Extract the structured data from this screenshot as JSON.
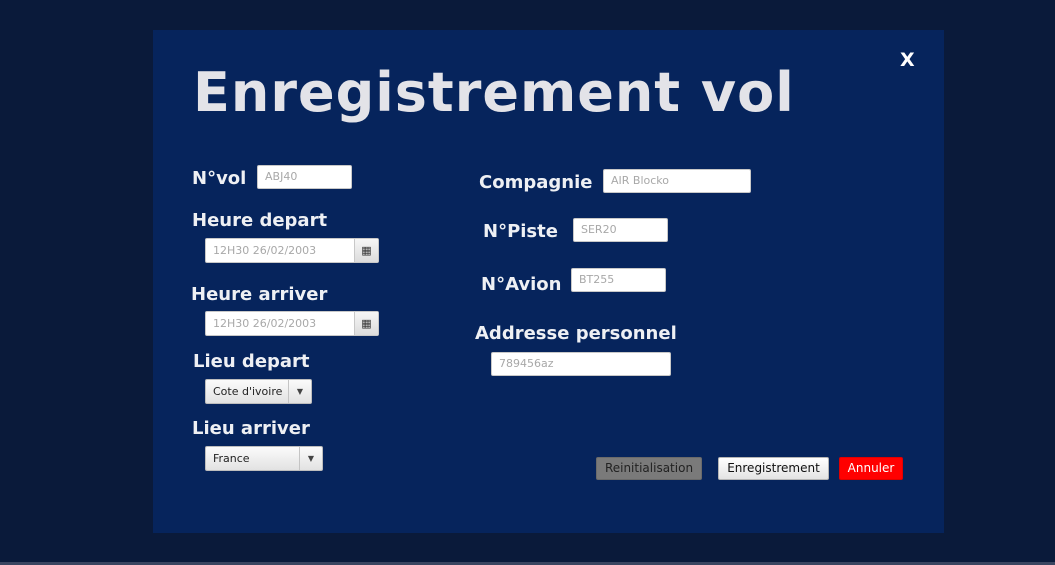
{
  "dialog": {
    "title": "Enregistrement vol",
    "close_label": "X"
  },
  "form": {
    "nvol": {
      "label": "N°vol",
      "value": "ABJ40"
    },
    "heure_depart": {
      "label": "Heure depart",
      "value": "12H30 26/02/2003",
      "icon": "calendar-icon"
    },
    "heure_arriver": {
      "label": "Heure arriver",
      "value": "12H30 26/02/2003",
      "icon": "calendar-icon"
    },
    "lieu_depart": {
      "label": "Lieu depart",
      "value": "Cote d'ivoire"
    },
    "lieu_arriver": {
      "label": "Lieu arriver",
      "value": "France"
    },
    "compagnie": {
      "label": "Compagnie",
      "value": "AIR Blocko"
    },
    "npiste": {
      "label": "N°Piste",
      "value": "SER20"
    },
    "navion": {
      "label": "N°Avion",
      "value": "BT255"
    },
    "adresse": {
      "label": "Addresse personnel",
      "value": "789456az"
    }
  },
  "buttons": {
    "reset": "Reinitialisation",
    "save": "Enregistrement",
    "cancel": "Annuler"
  },
  "colors": {
    "background": "#0a1a3a",
    "dialog": "#06245c",
    "cancel": "#ff0000",
    "reset": "#7a7a7a"
  }
}
